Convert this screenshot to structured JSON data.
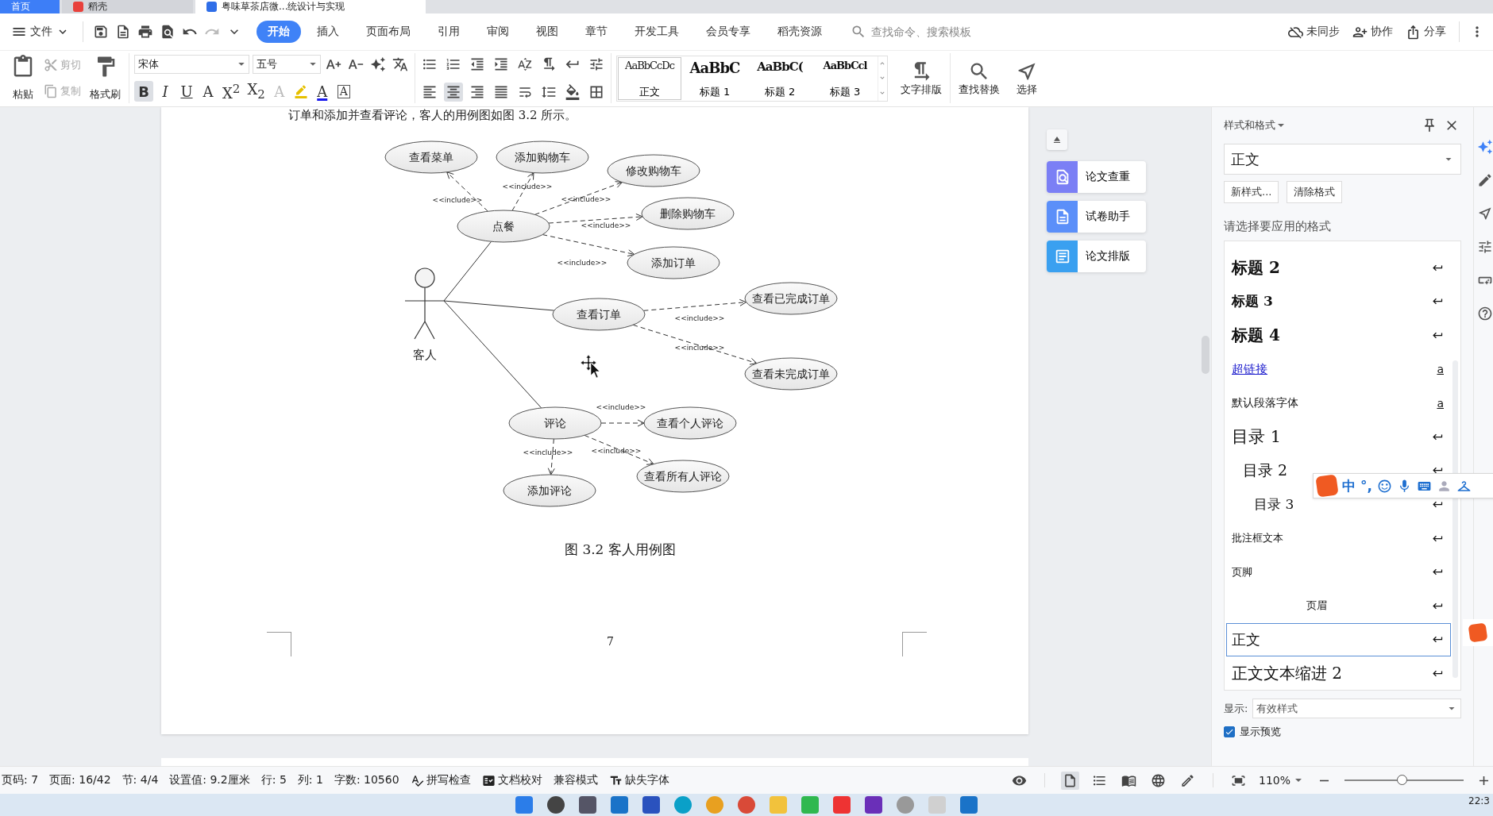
{
  "tabs": [
    {
      "label": "首页",
      "kind": "home",
      "selected": false
    },
    {
      "label": "稻壳",
      "kind": "app",
      "selected": false
    },
    {
      "label": "粤味草茶店微...统设计与实现",
      "kind": "document",
      "selected": true
    }
  ],
  "menu": {
    "file": "文件",
    "tabs": [
      {
        "label": "开始",
        "selected": true
      },
      {
        "label": "插入",
        "selected": false
      },
      {
        "label": "页面布局",
        "selected": false
      },
      {
        "label": "引用",
        "selected": false
      },
      {
        "label": "审阅",
        "selected": false
      },
      {
        "label": "视图",
        "selected": false
      },
      {
        "label": "章节",
        "selected": false
      },
      {
        "label": "开发工具",
        "selected": false
      },
      {
        "label": "会员专享",
        "selected": false
      },
      {
        "label": "稻壳资源",
        "selected": false
      }
    ],
    "search": {
      "placeholder": "查找命令、搜索模板"
    },
    "actions": [
      {
        "label": "未同步",
        "kind": "sync"
      },
      {
        "label": "协作",
        "kind": "collab"
      },
      {
        "label": "分享",
        "kind": "share"
      }
    ]
  },
  "ribbon": {
    "paste": "粘贴",
    "clipboard": [
      {
        "label": "剪切",
        "kind": "cut",
        "disabled": true
      },
      {
        "label": "复制",
        "kind": "copy",
        "disabled": true
      }
    ],
    "format_painter": "格式刷",
    "font": {
      "family": "宋体",
      "size": "五号"
    },
    "format_buttons": [
      {
        "label": "B",
        "kind": "bold",
        "selected": true
      },
      {
        "label": "I",
        "kind": "italic",
        "selected": false
      },
      {
        "label": "U",
        "kind": "underline",
        "selected": false
      },
      {
        "label": "A",
        "kind": "strike",
        "selected": false
      },
      {
        "label": "X$^{2}$",
        "kind": "script",
        "selected": false
      },
      {
        "label": "X$_{2}$",
        "kind": "script",
        "selected": false
      },
      {
        "label": "A",
        "kind": "effect",
        "selected": false
      },
      {
        "kind": "highlight",
        "selected": false
      },
      {
        "label": "A",
        "kind": "color",
        "selected": false
      },
      {
        "label": "A",
        "kind": "border",
        "selected": false
      }
    ],
    "alignment": [
      {
        "kind": "left",
        "selected": false
      },
      {
        "kind": "center",
        "selected": true
      },
      {
        "kind": "right",
        "selected": false
      },
      {
        "kind": "justify",
        "selected": false
      },
      {
        "kind": "distributed",
        "selected": false
      }
    ],
    "styles": [
      {
        "sample": "AaBbCcDc",
        "name": "正文",
        "kind": "body",
        "selected": true
      },
      {
        "sample": "AaBbC",
        "name": "标题 1",
        "kind": "h1",
        "selected": false
      },
      {
        "sample": "AaBbC(",
        "name": "标题 2",
        "kind": "h2",
        "selected": false
      },
      {
        "sample": "AaBbCcl",
        "name": "标题 3",
        "kind": "h3",
        "selected": false
      }
    ],
    "tools": [
      {
        "label": "文字排版",
        "kind": "layout"
      },
      {
        "label": "查找替换",
        "kind": "find"
      },
      {
        "label": "选择",
        "kind": "select"
      }
    ]
  },
  "document": {
    "lead_text": "订单和添加并查看评论，客人的用例图如图 3.2 所示。",
    "diagram": {
      "actor": "客人",
      "use_cases": [
        "查看菜单",
        "添加购物车",
        "修改购物车",
        "删除购物车",
        "添加订单",
        "点餐",
        "查看订单",
        "查看已完成订单",
        "查看未完成订单",
        "评论",
        "查看个人评论",
        "查看所有人评论",
        "添加评论"
      ],
      "includes": [
        "<<include>>",
        "<<include>>",
        "<<include>>",
        "<<include>>",
        "<<include>>",
        "<<include>>",
        "<<include>>",
        "<<include>>",
        "<<include>>",
        "<<include>>"
      ]
    },
    "caption": "图 3.2 客人用例图",
    "page_number": "7"
  },
  "side_tools": [
    {
      "label": "论文查重",
      "color": "#7b7ff5"
    },
    {
      "label": "试卷助手",
      "color": "#5b8ff9"
    },
    {
      "label": "论文排版",
      "color": "#3aa0f0"
    }
  ],
  "panel": {
    "title": "样式和格式",
    "current": "正文",
    "buttons": [
      "新样式...",
      "清除格式"
    ],
    "prompt": "请选择要应用的格式",
    "styles": [
      {
        "label": "标题 2",
        "kind": "heading2",
        "selected": false
      },
      {
        "label": "标题 3",
        "kind": "heading3",
        "selected": false
      },
      {
        "label": "标题 4",
        "kind": "heading4",
        "selected": false
      },
      {
        "label": "超链接",
        "kind": "hyperlink",
        "marker": "a",
        "selected": false
      },
      {
        "label": "默认段落字体",
        "kind": "plain",
        "marker": "a",
        "selected": false
      },
      {
        "label": "目录 1",
        "kind": "toc1",
        "selected": false
      },
      {
        "label": "目录 2",
        "kind": "toc2",
        "selected": false
      },
      {
        "label": "目录 3",
        "kind": "toc3",
        "selected": false
      },
      {
        "label": "批注框文本",
        "kind": "small",
        "selected": false
      },
      {
        "label": "页脚",
        "kind": "small",
        "selected": false
      },
      {
        "label": "页眉",
        "kind": "centered",
        "selected": false
      },
      {
        "label": "正文",
        "kind": "body",
        "selected": true
      },
      {
        "label": "正文文本缩进 2",
        "kind": "indent",
        "selected": false
      }
    ],
    "show_label": "显示:",
    "show_value": "有效样式",
    "preview": {
      "label": "显示预览",
      "checked": true
    }
  },
  "ime": {
    "mode": "中",
    "punct": "°,"
  },
  "status": {
    "fields": [
      "页码: 7",
      "页面: 16/42",
      "节: 4/4",
      "设置值: 9.2厘米",
      "行: 5",
      "列: 1",
      "字数: 10560"
    ],
    "tools": [
      {
        "label": "拼写检查",
        "kind": "spell"
      },
      {
        "label": "文档校对",
        "kind": "proof"
      },
      {
        "label": "兼容模式",
        "kind": "plain"
      },
      {
        "label": "缺失字体",
        "kind": "font"
      }
    ],
    "views": [
      {
        "kind": "page",
        "selected": true
      },
      {
        "kind": "outline",
        "selected": false
      },
      {
        "kind": "read",
        "selected": false
      },
      {
        "kind": "web",
        "selected": false
      },
      {
        "kind": "write",
        "selected": false
      }
    ],
    "zoom": "110%",
    "zoom_slider": {
      "level": 0.48
    }
  },
  "taskbar": {
    "clock": "22:3"
  }
}
